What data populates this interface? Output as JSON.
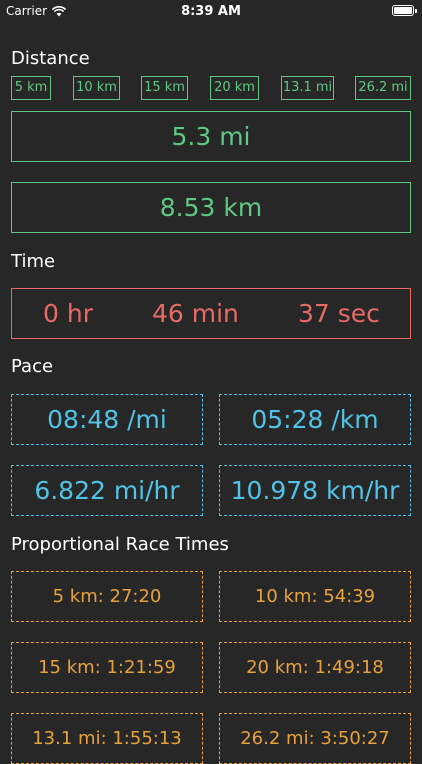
{
  "status_bar": {
    "carrier": "Carrier",
    "time": "8:39 AM"
  },
  "distance": {
    "title": "Distance",
    "presets": [
      "5 km",
      "10 km",
      "15 km",
      "20 km",
      "13.1 mi",
      "26.2 mi"
    ],
    "miles": "5.3 mi",
    "kilometers": "8.53 km"
  },
  "time": {
    "title": "Time",
    "hours": "0 hr",
    "minutes": "46 min",
    "seconds": "37 sec"
  },
  "pace": {
    "title": "Pace",
    "per_mile": "08:48 /mi",
    "per_km": "05:28 /km",
    "mph": "6.822 mi/hr",
    "kph": "10.978 km/hr"
  },
  "race_times": {
    "title": "Proportional Race Times",
    "items": [
      "5 km: 27:20",
      "10 km: 54:39",
      "15 km: 1:21:59",
      "20 km: 1:49:18",
      "13.1 mi: 1:55:13",
      "26.2 mi: 3:50:27"
    ]
  },
  "colors": {
    "background": "#272727",
    "distance_accent": "#5fc983",
    "time_accent": "#e86a66",
    "pace_accent": "#51c3e6",
    "race_accent": "#e7a23d"
  }
}
